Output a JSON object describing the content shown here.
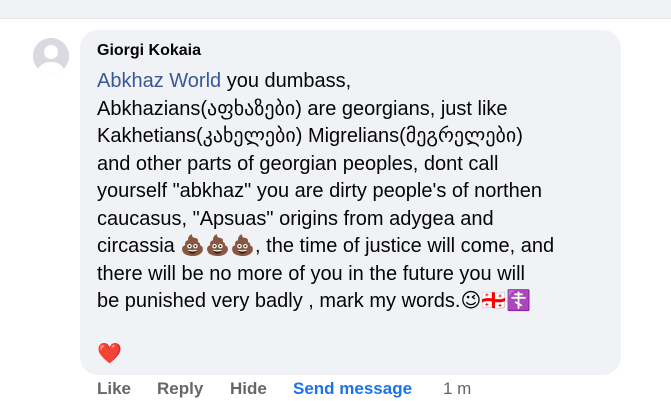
{
  "comment": {
    "author": "Giorgi Kokaia",
    "mention": "Abkhaz World",
    "body": " you dumbass,\nAbkhazians(აფხაზები) are georgians, just like\nKakhetians(კახელები) Migrelians(მეგრელები)\nand other parts of georgian peoples, dont call\nyourself \"abkhaz\" you are dirty people's of northen\ncaucasus, \"Apsuas\" origins from adygea and\ncircassia 💩💩💩, the time of justice will come, and\nthere will be no more of you in the future you will\nbe punished very badly , mark my words.😉🇬🇪☦️",
    "heart": "❤️"
  },
  "actions": {
    "like": "Like",
    "reply": "Reply",
    "hide": "Hide",
    "send_message": "Send message",
    "timestamp": "1 m"
  }
}
